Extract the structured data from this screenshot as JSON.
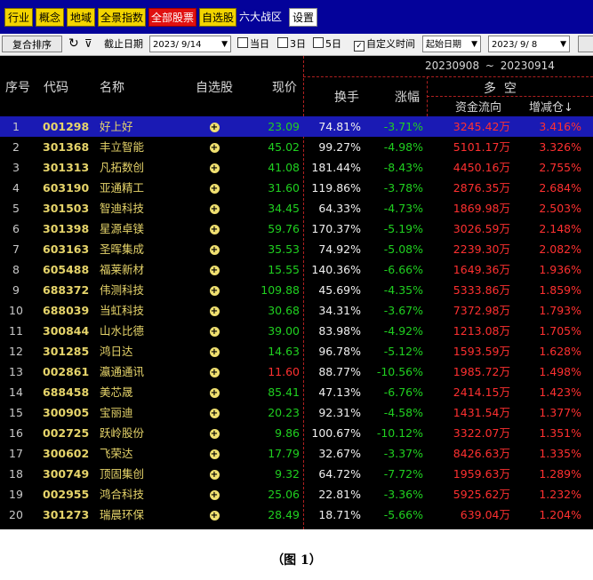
{
  "nav": {
    "items": [
      "行业",
      "概念",
      "地域",
      "全景指数",
      "全部股票",
      "自选股"
    ],
    "plain_label": "六大战区",
    "settings_label": "设置"
  },
  "toolbar": {
    "reset_sort": "复合排序",
    "refresh_icon": "refresh-icon",
    "filter_icon": "filter-clear-icon",
    "end_date_label": "截止日期",
    "end_date_value": "2023/ 9/14",
    "opt_today": "当日",
    "opt_3day": "3日",
    "opt_5day": "5日",
    "opt_custom": "自定义时间",
    "start_select": "起始日期",
    "start_date_value": "2023/ 9/ 8"
  },
  "table": {
    "headers": {
      "idx": "序号",
      "code": "代码",
      "name": "名称",
      "fav": "自选股",
      "price": "现价",
      "turnover": "换手",
      "change": "涨幅",
      "longshort": "多  空",
      "flow": "资金流向",
      "increase": "增减仓↓"
    },
    "date_range": {
      "start": "20230908",
      "sep": "~",
      "end": "20230914"
    },
    "rows": [
      {
        "idx": "1",
        "code": "001298",
        "name": "好上好",
        "price": "23.09",
        "price_color": "#20d020",
        "turnover": "74.81%",
        "change": "-3.71%",
        "flow": "3245.42万",
        "increase": "3.416%",
        "selected": true
      },
      {
        "idx": "2",
        "code": "301368",
        "name": "丰立智能",
        "price": "45.02",
        "price_color": "#20d020",
        "turnover": "99.27%",
        "change": "-4.98%",
        "flow": "5101.17万",
        "increase": "3.326%"
      },
      {
        "idx": "3",
        "code": "301313",
        "name": "凡拓数创",
        "price": "41.08",
        "price_color": "#20d020",
        "turnover": "181.44%",
        "change": "-8.43%",
        "flow": "4450.16万",
        "increase": "2.755%"
      },
      {
        "idx": "4",
        "code": "603190",
        "name": "亚通精工",
        "price": "31.60",
        "price_color": "#20d020",
        "turnover": "119.86%",
        "change": "-3.78%",
        "flow": "2876.35万",
        "increase": "2.684%"
      },
      {
        "idx": "5",
        "code": "301503",
        "name": "智迪科技",
        "price": "34.45",
        "price_color": "#20d020",
        "turnover": "64.33%",
        "change": "-4.73%",
        "flow": "1869.98万",
        "increase": "2.503%"
      },
      {
        "idx": "6",
        "code": "301398",
        "name": "星源卓镁",
        "price": "59.76",
        "price_color": "#20d020",
        "turnover": "170.37%",
        "change": "-5.19%",
        "flow": "3026.59万",
        "increase": "2.148%"
      },
      {
        "idx": "7",
        "code": "603163",
        "name": "圣晖集成",
        "price": "35.53",
        "price_color": "#20d020",
        "turnover": "74.92%",
        "change": "-5.08%",
        "flow": "2239.30万",
        "increase": "2.082%"
      },
      {
        "idx": "8",
        "code": "605488",
        "name": "福莱新材",
        "price": "15.55",
        "price_color": "#20d020",
        "turnover": "140.36%",
        "change": "-6.66%",
        "flow": "1649.36万",
        "increase": "1.936%"
      },
      {
        "idx": "9",
        "code": "688372",
        "name": "伟测科技",
        "price": "109.88",
        "price_color": "#20d020",
        "turnover": "45.69%",
        "change": "-4.35%",
        "flow": "5333.86万",
        "increase": "1.859%"
      },
      {
        "idx": "10",
        "code": "688039",
        "name": "当虹科技",
        "price": "30.68",
        "price_color": "#20d020",
        "turnover": "34.31%",
        "change": "-3.67%",
        "flow": "7372.98万",
        "increase": "1.793%"
      },
      {
        "idx": "11",
        "code": "300844",
        "name": "山水比德",
        "price": "39.00",
        "price_color": "#20d020",
        "turnover": "83.98%",
        "change": "-4.92%",
        "flow": "1213.08万",
        "increase": "1.705%"
      },
      {
        "idx": "12",
        "code": "301285",
        "name": "鸿日达",
        "price": "14.63",
        "price_color": "#20d020",
        "turnover": "96.78%",
        "change": "-5.12%",
        "flow": "1593.59万",
        "increase": "1.628%"
      },
      {
        "idx": "13",
        "code": "002861",
        "name": "瀛通通讯",
        "price": "11.60",
        "price_color": "#ff3030",
        "turnover": "88.77%",
        "change": "-10.56%",
        "flow": "1985.72万",
        "increase": "1.498%"
      },
      {
        "idx": "14",
        "code": "688458",
        "name": "美芯晟",
        "price": "85.41",
        "price_color": "#20d020",
        "turnover": "47.13%",
        "change": "-6.76%",
        "flow": "2414.15万",
        "increase": "1.423%"
      },
      {
        "idx": "15",
        "code": "300905",
        "name": "宝丽迪",
        "price": "20.23",
        "price_color": "#20d020",
        "turnover": "92.31%",
        "change": "-4.58%",
        "flow": "1431.54万",
        "increase": "1.377%"
      },
      {
        "idx": "16",
        "code": "002725",
        "name": "跃岭股份",
        "price": "9.86",
        "price_color": "#20d020",
        "turnover": "100.67%",
        "change": "-10.12%",
        "flow": "3322.07万",
        "increase": "1.351%"
      },
      {
        "idx": "17",
        "code": "300602",
        "name": "飞荣达",
        "price": "17.79",
        "price_color": "#20d020",
        "turnover": "32.67%",
        "change": "-3.37%",
        "flow": "8426.63万",
        "increase": "1.335%"
      },
      {
        "idx": "18",
        "code": "300749",
        "name": "顶固集创",
        "price": "9.32",
        "price_color": "#20d020",
        "turnover": "64.72%",
        "change": "-7.72%",
        "flow": "1959.63万",
        "increase": "1.289%"
      },
      {
        "idx": "19",
        "code": "002955",
        "name": "鸿合科技",
        "price": "25.06",
        "price_color": "#20d020",
        "turnover": "22.81%",
        "change": "-3.36%",
        "flow": "5925.62万",
        "increase": "1.232%"
      },
      {
        "idx": "20",
        "code": "301273",
        "name": "瑞晨环保",
        "price": "28.49",
        "price_color": "#20d020",
        "turnover": "18.71%",
        "change": "-5.66%",
        "flow": "639.04万",
        "increase": "1.204%"
      }
    ]
  },
  "caption": "（图 1）"
}
